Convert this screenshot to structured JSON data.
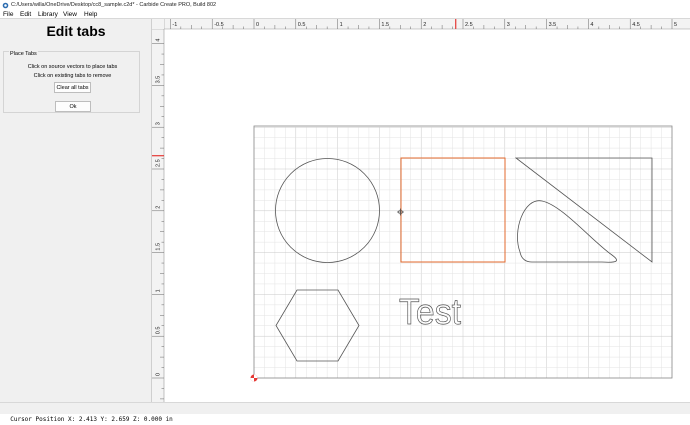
{
  "window": {
    "title": "C:/Users/willa/OneDrive/Desktop/cc8_sample.c2d* - Carbide Create PRO, Build 802"
  },
  "menu": [
    {
      "label": "File",
      "mnemonic": "F"
    },
    {
      "label": "Edit",
      "mnemonic": "E"
    },
    {
      "label": "Library",
      "mnemonic": "L"
    },
    {
      "label": "View",
      "mnemonic": "V"
    },
    {
      "label": "Help",
      "mnemonic": "H"
    }
  ],
  "panel": {
    "title": "Edit tabs",
    "group_label": "Place Tabs",
    "instruction_1": "Click on source vectors to place tabs",
    "instruction_2": "Click on existing tabs to remove",
    "clear_button": "Clear all tabs",
    "ok_button": "Ok"
  },
  "ruler": {
    "x_ticks": [
      "-1",
      "-0.5",
      "0",
      "0.5",
      "1",
      "1.5",
      "2",
      "2.5",
      "3",
      "3.5",
      "4",
      "4.5",
      "5"
    ],
    "y_ticks": [
      "0",
      "0.5",
      "1",
      "1.5",
      "2",
      "2.5",
      "3",
      "3.5",
      "4"
    ],
    "cursor_x": 2.413,
    "cursor_y": 2.659
  },
  "workspace": {
    "width_in": 5,
    "height_in": 3,
    "grid_step_in": 0.125,
    "text_object": "Test",
    "selected_color": "#e36a2e",
    "vector_color": "#555555"
  },
  "status": {
    "label": "Cursor Position",
    "text": "Cursor Position X: 2.413 Y: 2.659 Z: 0.000 in"
  }
}
